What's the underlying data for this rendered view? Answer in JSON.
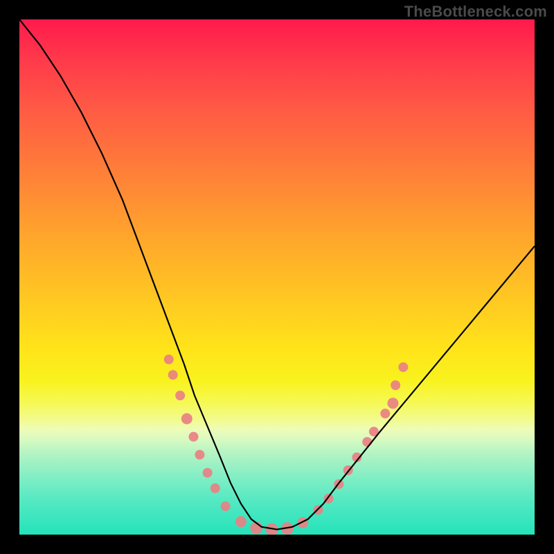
{
  "watermark": "TheBottleneck.com",
  "chart_data": {
    "type": "line",
    "title": "",
    "xlabel": "",
    "ylabel": "",
    "xlim": [
      0,
      100
    ],
    "ylim": [
      0,
      100
    ],
    "grid": false,
    "legend": false,
    "gradient_description": "vertical gradient from red (top) through orange/yellow to green (bottom)",
    "background": "black frame",
    "series": [
      {
        "name": "curve",
        "stroke": "#000000",
        "x": [
          0,
          4,
          8,
          12,
          16,
          20,
          23,
          26,
          29,
          32,
          34,
          36.5,
          39,
          41,
          43,
          45,
          47,
          50,
          53,
          56,
          59,
          62,
          66,
          70,
          75,
          80,
          85,
          90,
          95,
          100
        ],
        "y": [
          100,
          95,
          89,
          82,
          74,
          65,
          57,
          49,
          41,
          33,
          27,
          21,
          15,
          10,
          6,
          3,
          1.5,
          1,
          1.5,
          3,
          6,
          10,
          15,
          20,
          26,
          32,
          38,
          44,
          50,
          56
        ]
      }
    ],
    "markers": {
      "color": "#e98083",
      "radius_range": [
        6,
        10
      ],
      "points": [
        {
          "x": 29.0,
          "y": 34.0,
          "r": 7
        },
        {
          "x": 29.8,
          "y": 31.0,
          "r": 7
        },
        {
          "x": 31.2,
          "y": 27.0,
          "r": 7
        },
        {
          "x": 32.5,
          "y": 22.5,
          "r": 8
        },
        {
          "x": 33.8,
          "y": 19.0,
          "r": 7
        },
        {
          "x": 35.0,
          "y": 15.5,
          "r": 7
        },
        {
          "x": 36.5,
          "y": 12.0,
          "r": 7
        },
        {
          "x": 38.0,
          "y": 9.0,
          "r": 7
        },
        {
          "x": 40.0,
          "y": 5.5,
          "r": 7
        },
        {
          "x": 43.0,
          "y": 2.5,
          "r": 8
        },
        {
          "x": 46.0,
          "y": 1.3,
          "r": 9
        },
        {
          "x": 49.0,
          "y": 1.0,
          "r": 9
        },
        {
          "x": 52.0,
          "y": 1.2,
          "r": 9
        },
        {
          "x": 55.0,
          "y": 2.3,
          "r": 8
        },
        {
          "x": 58.0,
          "y": 4.8,
          "r": 7
        },
        {
          "x": 60.0,
          "y": 7.0,
          "r": 7
        },
        {
          "x": 62.0,
          "y": 9.8,
          "r": 7
        },
        {
          "x": 63.8,
          "y": 12.5,
          "r": 7
        },
        {
          "x": 65.5,
          "y": 15.0,
          "r": 7
        },
        {
          "x": 67.5,
          "y": 18.0,
          "r": 7
        },
        {
          "x": 68.8,
          "y": 20.0,
          "r": 7
        },
        {
          "x": 71.0,
          "y": 23.5,
          "r": 7
        },
        {
          "x": 72.5,
          "y": 25.5,
          "r": 8
        },
        {
          "x": 73.0,
          "y": 29.0,
          "r": 7
        },
        {
          "x": 74.5,
          "y": 32.5,
          "r": 7
        }
      ]
    }
  }
}
